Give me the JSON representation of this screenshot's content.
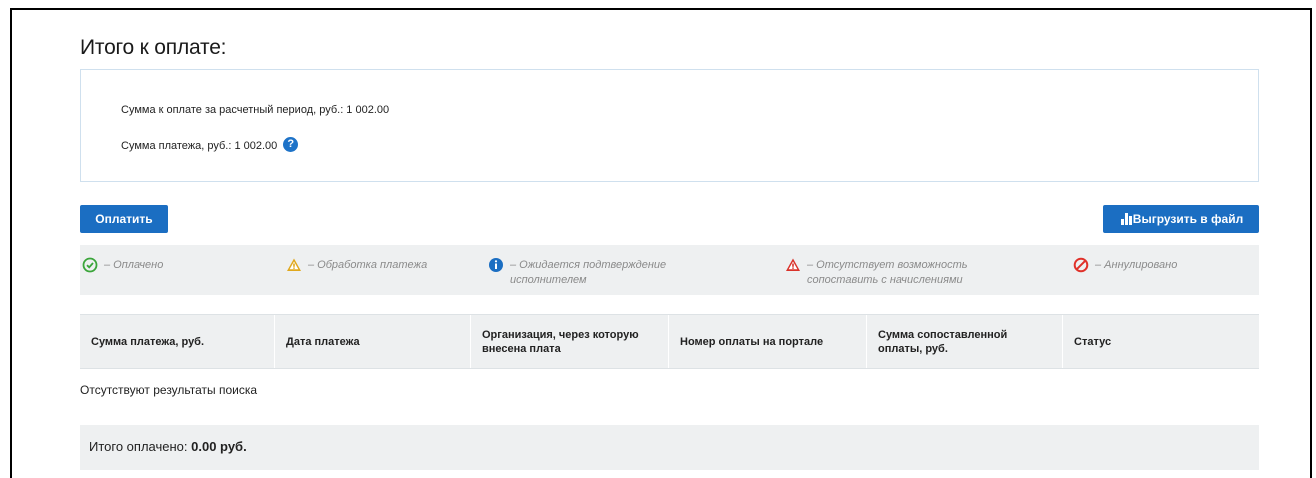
{
  "header": {
    "title": "Итого к оплате:"
  },
  "summary": {
    "period_sum": "Сумма к оплате за расчетный период, руб.: 1 002.00",
    "payment_sum": "Сумма платежа, руб.: 1 002.00",
    "help_icon": "question-circle-icon"
  },
  "actions": {
    "pay_label": "Оплатить",
    "export_label": "Выгрузить в файл"
  },
  "legend": [
    {
      "icon": "check-circle-icon",
      "color": "#3aa53a",
      "label": "– Оплачено"
    },
    {
      "icon": "warning-triangle-icon",
      "color": "#e0a81d",
      "label": "– Обработка платежа"
    },
    {
      "icon": "info-circle-icon",
      "color": "#1b6ec2",
      "label": "– Ожидается подтверждение исполнителем"
    },
    {
      "icon": "warning-triangle-red-icon",
      "color": "#d9322a",
      "label": "– Отсутствует возможность сопоставить с начислениями"
    },
    {
      "icon": "cancel-circle-icon",
      "color": "#e0312a",
      "label": "– Аннулировано"
    }
  ],
  "table": {
    "columns": [
      "Сумма платежа, руб.",
      "Дата платежа",
      "Организация, через которую внесена плата",
      "Номер оплаты на портале",
      "Сумма сопоставленной оплаты, руб.",
      "Статус"
    ],
    "empty_text": "Отсутствуют результаты поиска"
  },
  "total": {
    "label": "Итого оплачено:",
    "value": "0.00 руб."
  }
}
